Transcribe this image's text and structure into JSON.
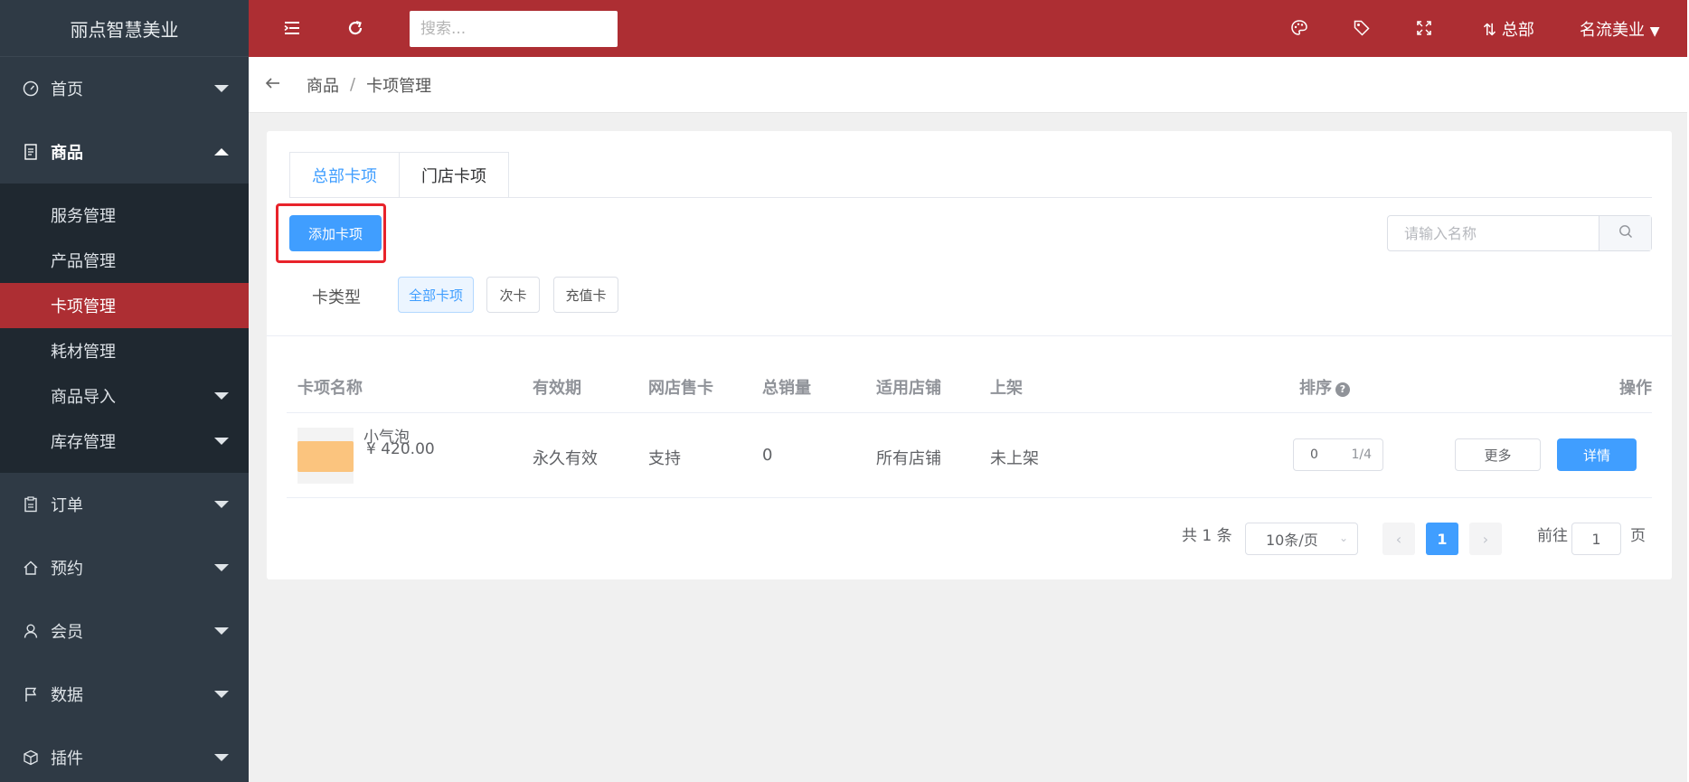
{
  "app": {
    "brand": "丽点智慧美业"
  },
  "sidebar": {
    "items": [
      {
        "label": "首页",
        "icon": "dashboard-icon"
      },
      {
        "label": "商品",
        "icon": "document-icon"
      },
      {
        "label": "订单",
        "icon": "clipboard-icon"
      },
      {
        "label": "预约",
        "icon": "home-icon"
      },
      {
        "label": "会员",
        "icon": "user-icon"
      },
      {
        "label": "数据",
        "icon": "flag-icon"
      },
      {
        "label": "插件",
        "icon": "cube-icon"
      }
    ],
    "sub_items": [
      {
        "label": "服务管理"
      },
      {
        "label": "产品管理"
      },
      {
        "label": "卡项管理"
      },
      {
        "label": "耗材管理"
      },
      {
        "label": "商品导入"
      },
      {
        "label": "库存管理"
      }
    ]
  },
  "topbar": {
    "search_placeholder": "搜索...",
    "hq_label": "总部",
    "store_label": "名流美业"
  },
  "breadcrumb": {
    "items": [
      "商品",
      "卡项管理"
    ],
    "separator": "/"
  },
  "tabs": [
    "总部卡项",
    "门店卡项"
  ],
  "toolbar": {
    "add_label": "添加卡项",
    "search_placeholder": "请输入名称"
  },
  "filter": {
    "label": "卡类型",
    "options": [
      "全部卡项",
      "次卡",
      "充值卡"
    ]
  },
  "table": {
    "headers": {
      "name": "卡项名称",
      "validity": "有效期",
      "online": "网店售卡",
      "sales": "总销量",
      "stores": "适用店铺",
      "listed": "上架",
      "sort": "排序",
      "help": "?",
      "actions": "操作"
    },
    "rows": [
      {
        "name": "小气泡",
        "price": "¥ 420.00",
        "validity": "永久有效",
        "online": "支持",
        "sales": "0",
        "stores": "所有店铺",
        "listed": "未上架",
        "sort_value": "0",
        "sort_count": "1/4",
        "more_label": "更多",
        "detail_label": "详情"
      }
    ]
  },
  "pagination": {
    "total": "共 1 条",
    "page_size": "10条/页",
    "current": "1",
    "goto_label": "前往",
    "goto_value": "1",
    "page_suffix": "页"
  },
  "colors": {
    "brand_red": "#ad2e33",
    "sidebar_bg": "#2f3a45",
    "primary_blue": "#409eff",
    "highlight_red": "#e8232b"
  }
}
